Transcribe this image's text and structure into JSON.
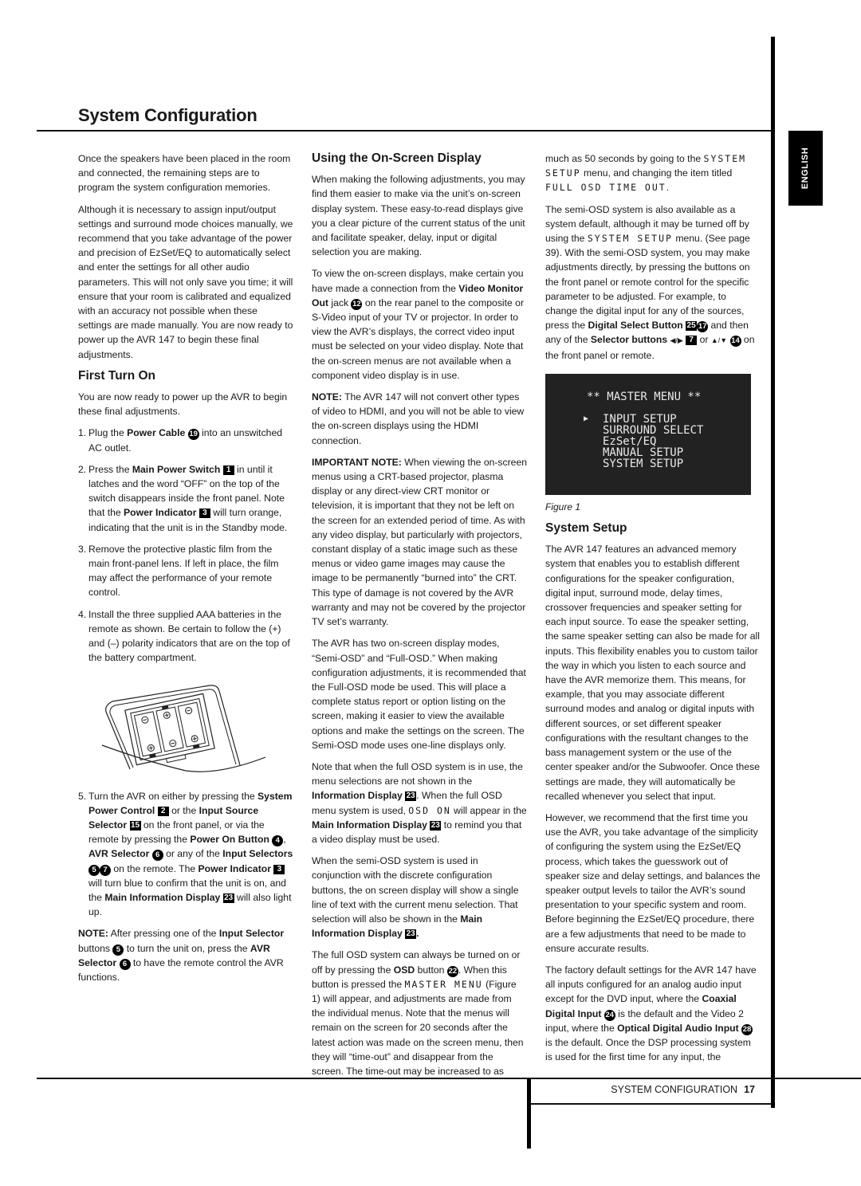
{
  "page": {
    "title": "System Configuration",
    "language_tab": "ENGLISH",
    "footer": {
      "section": "SYSTEM CONFIGURATION",
      "page_number": "17"
    }
  },
  "col1": {
    "intro1": "Once the speakers have been placed in the room and connected, the remaining steps are to program the system configuration memories.",
    "intro2": "Although it is necessary to assign input/output settings and surround mode choices manually, we recommend that you take advantage of the power and precision of EzSet/EQ to automatically select and enter the settings for all other audio parameters. This will not only save you time; it will ensure that your room is calibrated and equalized with an accuracy not possible when these settings are made manually. You are now ready to power up the AVR 147 to begin these final adjustments.",
    "first_turn_on": {
      "heading": "First Turn On",
      "intro": "You are now ready to power up the AVR to begin these final adjustments.",
      "steps": [
        {
          "num": "1.",
          "t1": "Plug the ",
          "b1": "Power Cable",
          "badge1": "19",
          "t2": " into an unswitched AC outlet."
        },
        {
          "num": "2.",
          "t1": "Press the ",
          "b1": "Main Power Switch",
          "badge1": "1",
          "t2": " in until it latches and the word “OFF” on the top of the switch disappears inside the front panel. Note that the ",
          "b2": "Power Indicator",
          "badge2": "3",
          "t3": " will turn orange, indicating that the unit is in the Standby mode."
        },
        {
          "num": "3.",
          "text": "Remove the protective plastic film from the main front-panel lens. If left in place, the film may affect the performance of your remote control."
        },
        {
          "num": "4.",
          "text": "Install the three supplied AAA batteries in the remote as shown. Be certain to follow the (+) and (–) polarity indicators that are on the top of the battery compartment."
        }
      ],
      "step5": {
        "num": "5.",
        "t1": "Turn the AVR on either by pressing the ",
        "b1": "System Power Control",
        "badge1": "2",
        "t2": " or the ",
        "b2": "Input Source Selector",
        "badge2": "15",
        "t3": " on the front panel, or via the remote by pressing the ",
        "b3": "Power On Button",
        "badge3": "4",
        "t4": ", ",
        "b4": "AVR Selector",
        "badge4": "6",
        "t5": " or any of the ",
        "b5": "Input Selectors",
        "badge5a": "5",
        "badge5b": "7",
        "t6": " on the remote. The ",
        "b6": "Power Indicator",
        "badge6": "3",
        "t7": " will turn blue to confirm that the unit is on, and the ",
        "b7": "Main Information Display",
        "badge7": "23",
        "t8": " will also light up."
      },
      "note": {
        "label": "NOTE:",
        "t1": " After pressing one of the ",
        "b1": "Input Selector",
        "t2": " buttons ",
        "badge1": "5",
        "t3": " to turn the unit on, press the ",
        "b2": "AVR Selector",
        "badge2": "6",
        "t4": " to have the remote control the AVR functions."
      }
    }
  },
  "col2": {
    "heading": "Using the On-Screen Display",
    "p1": "When making the following adjustments, you may find them easier to make via the unit’s on-screen display system. These easy-to-read displays give you a clear picture of the current status of the unit and facilitate speaker, delay, input or digital selection you are making.",
    "p2": {
      "t1": "To view the on-screen displays, make certain you have made a connection from the ",
      "b1": "Video Monitor Out",
      "t2": " jack ",
      "badge1": "12",
      "t3": " on the rear panel to the composite or S-Video input of your TV or projector. In order to view the AVR’s displays, the correct video input must be selected on your video display. Note that the on-screen menus are not available when a component video display is in use."
    },
    "note": {
      "label": "NOTE:",
      "text": " The AVR 147 will not convert other types of video to HDMI, and you will not be able to view the on-screen displays using the HDMI connection."
    },
    "important": {
      "label": "IMPORTANT NOTE:",
      "text": " When viewing the on-screen menus using a CRT-based projector, plasma display or any direct-view CRT monitor or television, it is important that they not be left on the screen for an extended period of time. As with any video display, but particularly with projectors, constant display of a static image such as these menus or video game images may cause the image to be permanently “burned into” the CRT. This type of damage is not covered by the AVR warranty and may not be covered by the projector TV set’s warranty."
    },
    "p3": "The AVR has two on-screen display modes, “Semi-OSD” and “Full-OSD.” When making configuration adjustments, it is recommended that the Full-OSD mode be used. This will place a complete status report or option listing on the screen, making it easier to view the available options and make the settings on the screen. The Semi-OSD mode uses one-line displays only.",
    "p4": {
      "t1": "Note that when the full OSD system is in use, the menu selections are not shown in the ",
      "b1": "Information Display",
      "badge1": "23",
      "t2": ". When the full OSD menu system is used, ",
      "lcd1": "OSD ON",
      "t3": " will appear in the ",
      "b2": "Main Information Display",
      "badge2": "23",
      "t4": " to remind you that a video display must be used."
    },
    "p5": {
      "t1": "When the semi-OSD system is used in conjunction with the discrete configuration buttons, the on screen display will show a single line of text with the current menu selection. That selection will also be shown in the ",
      "b1": "Main Information Display",
      "badge1": "23",
      "t2": "."
    },
    "p6": {
      "t1": "The full OSD system can always be turned on or off by pressing the ",
      "b1": "OSD",
      "t2": " button ",
      "badge1": "22",
      "t3": ". When this button is pressed the ",
      "lcd1": "MASTER MENU",
      "t4": " (Figure 1) will appear, and adjustments are made from the individual menus. Note that the menus will remain on the screen for 20 seconds after the latest action was made on the screen menu, then they will “time-out” and disappear from the screen. The time-out may be increased to as"
    }
  },
  "col3": {
    "p1": {
      "t1": "much as 50 seconds by going to the ",
      "lcd1": "SYSTEM SETUP",
      "t2": " menu, and changing the item titled ",
      "lcd2": "FULL OSD TIME OUT",
      "t3": "."
    },
    "p2": {
      "t1": "The semi-OSD system is also available as a system default, although it may be turned off by using the ",
      "lcd1": "SYSTEM SETUP",
      "t2": " menu. (See page 39). With the semi-OSD system, you may make adjustments directly, by pressing the buttons on the front panel or remote control for the specific parameter to be adjusted. For example, to change the digital input for any of the sources, press the ",
      "b1": "Digital Select Button",
      "badge1": "25",
      "badge2": "17",
      "t3": " and then any of the ",
      "b2": "Selector buttons",
      "arrows1": "◀/▶",
      "badge3": "7",
      "t4": " or ",
      "arrows2": "▲/▼",
      "badge4": "14",
      "t5": " on the front panel or remote."
    },
    "figure": {
      "menu_title": "** MASTER MENU **",
      "cursor": "▶",
      "items": [
        "INPUT SETUP",
        "SURROUND SELECT",
        "EzSet/EQ",
        "MANUAL SETUP",
        "SYSTEM SETUP"
      ],
      "caption": "Figure 1"
    },
    "system_setup": {
      "heading": "System Setup",
      "p1": "The AVR 147 features an advanced memory system that enables you to establish different configurations for the speaker configuration, digital input, surround mode, delay times, crossover frequencies and speaker setting for each input source. To ease the speaker setting, the same speaker setting can also be made for all inputs. This flexibility enables you to custom tailor the way in which you listen to each source and have the AVR memorize them. This means, for example, that you may associate different surround modes and analog or digital inputs with different sources, or set different speaker configurations with the resultant changes to the bass management system or the use of the center speaker and/or the Subwoofer. Once these settings are made, they will automatically be recalled whenever you select that input.",
      "p2": "However, we recommend that the first time you use the AVR, you take advantage of the simplicity of configuring the system using the EzSet/EQ process, which takes the guesswork out of speaker size and delay settings, and balances the speaker output levels to tailor the AVR’s sound presentation to your specific system and room. Before beginning the EzSet/EQ procedure, there are a few adjustments that need to be made to ensure accurate results.",
      "p3": {
        "t1": "The factory default settings for the AVR 147 have all inputs configured for an analog audio input except for the DVD input, where the ",
        "b1": "Coaxial Digital Input",
        "badge1": "24",
        "t2": " is the default and the Video 2 input, where the ",
        "b2": "Optical Digital Audio Input",
        "badge2": "28",
        "t3": " is the default. Once the DSP processing system is used for the first time for any input, the"
      }
    }
  }
}
